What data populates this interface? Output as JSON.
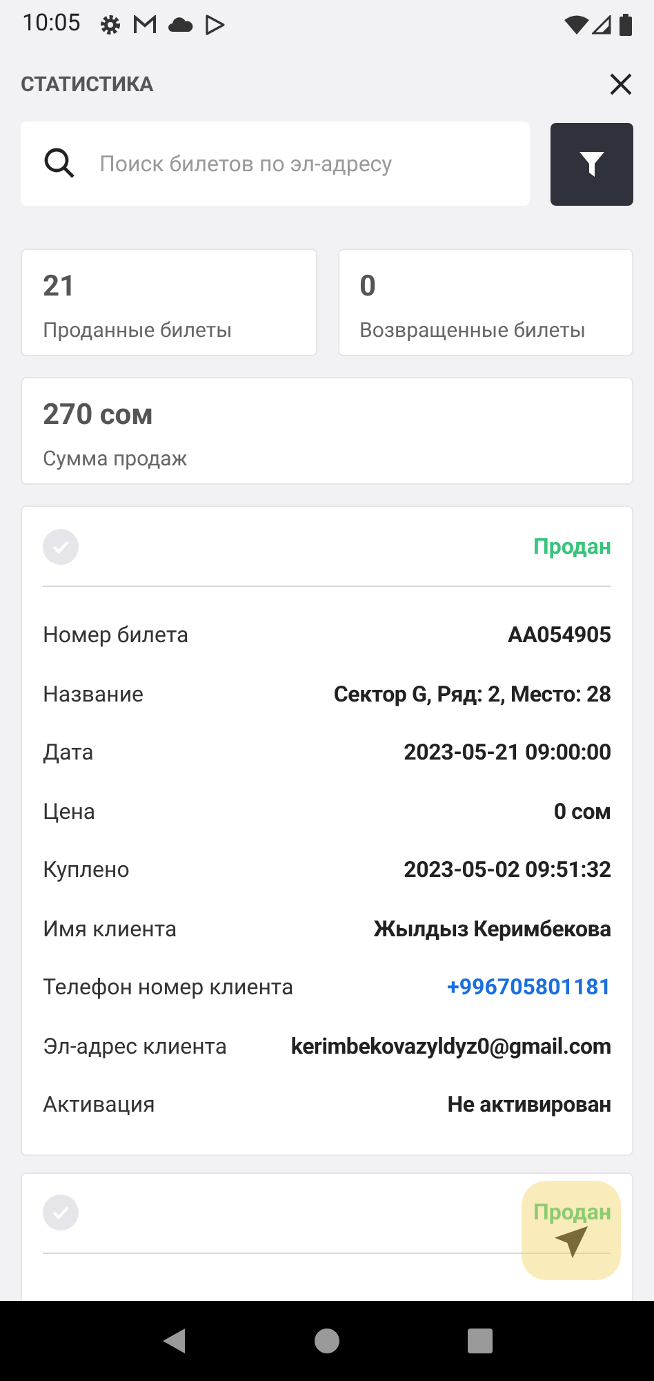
{
  "status_bar": {
    "time": "10:05"
  },
  "header": {
    "title": "СТАТИСТИКА"
  },
  "search": {
    "placeholder": "Поиск билетов по эл-адресу"
  },
  "stats": [
    {
      "value": "21",
      "label": "Проданные билеты"
    },
    {
      "value": "0",
      "label": "Возвращенные билеты"
    },
    {
      "value": "270 сом",
      "label": "Сумма продаж"
    }
  ],
  "tickets": [
    {
      "checked": false,
      "status": "Продан",
      "rows": [
        {
          "label": "Номер билета",
          "value": "AA054905",
          "kind": "text"
        },
        {
          "label": "Название",
          "value": "Сектор G, Ряд: 2, Место: 28",
          "kind": "text"
        },
        {
          "label": "Дата",
          "value": "2023-05-21 09:00:00",
          "kind": "text"
        },
        {
          "label": "Цена",
          "value": "0 сом",
          "kind": "text"
        },
        {
          "label": "Куплено",
          "value": "2023-05-02 09:51:32",
          "kind": "text"
        },
        {
          "label": "Имя клиента",
          "value": "Жылдыз Керимбекова",
          "kind": "text"
        },
        {
          "label": "Телефон номер клиента",
          "value": "+996705801181",
          "kind": "phone"
        },
        {
          "label": "Эл-адрес клиента",
          "value": "kerimbekovazyldyz0@gmail.com",
          "kind": "text"
        },
        {
          "label": "Активация",
          "value": "Не активирован",
          "kind": "text"
        }
      ]
    },
    {
      "checked": false,
      "status": "Продан"
    }
  ]
}
